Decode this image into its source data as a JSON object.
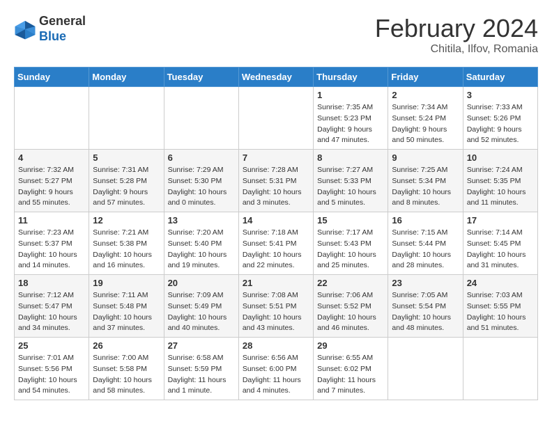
{
  "header": {
    "logo_general": "General",
    "logo_blue": "Blue",
    "month_title": "February 2024",
    "location": "Chitila, Ilfov, Romania"
  },
  "weekdays": [
    "Sunday",
    "Monday",
    "Tuesday",
    "Wednesday",
    "Thursday",
    "Friday",
    "Saturday"
  ],
  "weeks": [
    [
      {
        "day": "",
        "info": ""
      },
      {
        "day": "",
        "info": ""
      },
      {
        "day": "",
        "info": ""
      },
      {
        "day": "",
        "info": ""
      },
      {
        "day": "1",
        "info": "Sunrise: 7:35 AM\nSunset: 5:23 PM\nDaylight: 9 hours\nand 47 minutes."
      },
      {
        "day": "2",
        "info": "Sunrise: 7:34 AM\nSunset: 5:24 PM\nDaylight: 9 hours\nand 50 minutes."
      },
      {
        "day": "3",
        "info": "Sunrise: 7:33 AM\nSunset: 5:26 PM\nDaylight: 9 hours\nand 52 minutes."
      }
    ],
    [
      {
        "day": "4",
        "info": "Sunrise: 7:32 AM\nSunset: 5:27 PM\nDaylight: 9 hours\nand 55 minutes."
      },
      {
        "day": "5",
        "info": "Sunrise: 7:31 AM\nSunset: 5:28 PM\nDaylight: 9 hours\nand 57 minutes."
      },
      {
        "day": "6",
        "info": "Sunrise: 7:29 AM\nSunset: 5:30 PM\nDaylight: 10 hours\nand 0 minutes."
      },
      {
        "day": "7",
        "info": "Sunrise: 7:28 AM\nSunset: 5:31 PM\nDaylight: 10 hours\nand 3 minutes."
      },
      {
        "day": "8",
        "info": "Sunrise: 7:27 AM\nSunset: 5:33 PM\nDaylight: 10 hours\nand 5 minutes."
      },
      {
        "day": "9",
        "info": "Sunrise: 7:25 AM\nSunset: 5:34 PM\nDaylight: 10 hours\nand 8 minutes."
      },
      {
        "day": "10",
        "info": "Sunrise: 7:24 AM\nSunset: 5:35 PM\nDaylight: 10 hours\nand 11 minutes."
      }
    ],
    [
      {
        "day": "11",
        "info": "Sunrise: 7:23 AM\nSunset: 5:37 PM\nDaylight: 10 hours\nand 14 minutes."
      },
      {
        "day": "12",
        "info": "Sunrise: 7:21 AM\nSunset: 5:38 PM\nDaylight: 10 hours\nand 16 minutes."
      },
      {
        "day": "13",
        "info": "Sunrise: 7:20 AM\nSunset: 5:40 PM\nDaylight: 10 hours\nand 19 minutes."
      },
      {
        "day": "14",
        "info": "Sunrise: 7:18 AM\nSunset: 5:41 PM\nDaylight: 10 hours\nand 22 minutes."
      },
      {
        "day": "15",
        "info": "Sunrise: 7:17 AM\nSunset: 5:43 PM\nDaylight: 10 hours\nand 25 minutes."
      },
      {
        "day": "16",
        "info": "Sunrise: 7:15 AM\nSunset: 5:44 PM\nDaylight: 10 hours\nand 28 minutes."
      },
      {
        "day": "17",
        "info": "Sunrise: 7:14 AM\nSunset: 5:45 PM\nDaylight: 10 hours\nand 31 minutes."
      }
    ],
    [
      {
        "day": "18",
        "info": "Sunrise: 7:12 AM\nSunset: 5:47 PM\nDaylight: 10 hours\nand 34 minutes."
      },
      {
        "day": "19",
        "info": "Sunrise: 7:11 AM\nSunset: 5:48 PM\nDaylight: 10 hours\nand 37 minutes."
      },
      {
        "day": "20",
        "info": "Sunrise: 7:09 AM\nSunset: 5:49 PM\nDaylight: 10 hours\nand 40 minutes."
      },
      {
        "day": "21",
        "info": "Sunrise: 7:08 AM\nSunset: 5:51 PM\nDaylight: 10 hours\nand 43 minutes."
      },
      {
        "day": "22",
        "info": "Sunrise: 7:06 AM\nSunset: 5:52 PM\nDaylight: 10 hours\nand 46 minutes."
      },
      {
        "day": "23",
        "info": "Sunrise: 7:05 AM\nSunset: 5:54 PM\nDaylight: 10 hours\nand 48 minutes."
      },
      {
        "day": "24",
        "info": "Sunrise: 7:03 AM\nSunset: 5:55 PM\nDaylight: 10 hours\nand 51 minutes."
      }
    ],
    [
      {
        "day": "25",
        "info": "Sunrise: 7:01 AM\nSunset: 5:56 PM\nDaylight: 10 hours\nand 54 minutes."
      },
      {
        "day": "26",
        "info": "Sunrise: 7:00 AM\nSunset: 5:58 PM\nDaylight: 10 hours\nand 58 minutes."
      },
      {
        "day": "27",
        "info": "Sunrise: 6:58 AM\nSunset: 5:59 PM\nDaylight: 11 hours\nand 1 minute."
      },
      {
        "day": "28",
        "info": "Sunrise: 6:56 AM\nSunset: 6:00 PM\nDaylight: 11 hours\nand 4 minutes."
      },
      {
        "day": "29",
        "info": "Sunrise: 6:55 AM\nSunset: 6:02 PM\nDaylight: 11 hours\nand 7 minutes."
      },
      {
        "day": "",
        "info": ""
      },
      {
        "day": "",
        "info": ""
      }
    ]
  ]
}
